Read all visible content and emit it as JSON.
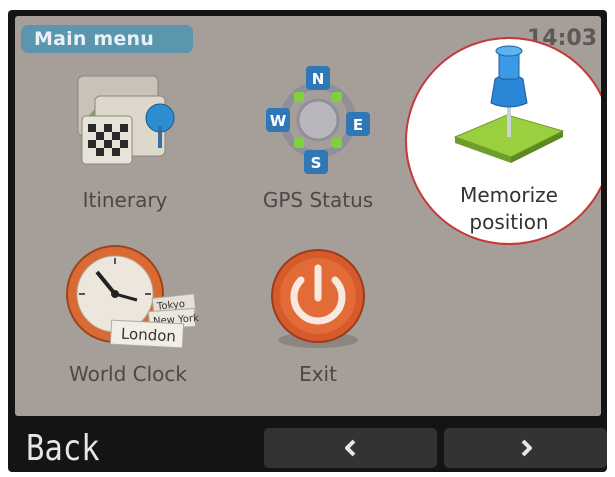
{
  "header": {
    "menu_title": "Main menu",
    "time": "14:03"
  },
  "menu": {
    "itinerary": "Itinerary",
    "gps_status": "GPS Status",
    "memorize_line1": "Memorize",
    "memorize_line2": "position",
    "world_clock": "World Clock",
    "exit": "Exit"
  },
  "icons": {
    "itinerary": "itinerary-map-icon",
    "gps": "compass-icon",
    "memorize": "pushpin-icon",
    "world_clock": "world-clock-icon",
    "exit": "power-icon"
  },
  "compass_letters": [
    "N",
    "W",
    "E",
    "S"
  ],
  "world_clock_cities": [
    "Tokyo",
    "New York",
    "London"
  ],
  "bottom_bar": {
    "back_label": "Back",
    "prev_icon": "chevron-left-icon",
    "next_icon": "chevron-right-icon"
  },
  "colors": {
    "screen_bg": "#a69e99",
    "menu_title_bg": "#5b95ae",
    "highlight_ring": "#c23a3a",
    "bar_bg": "#141414"
  }
}
